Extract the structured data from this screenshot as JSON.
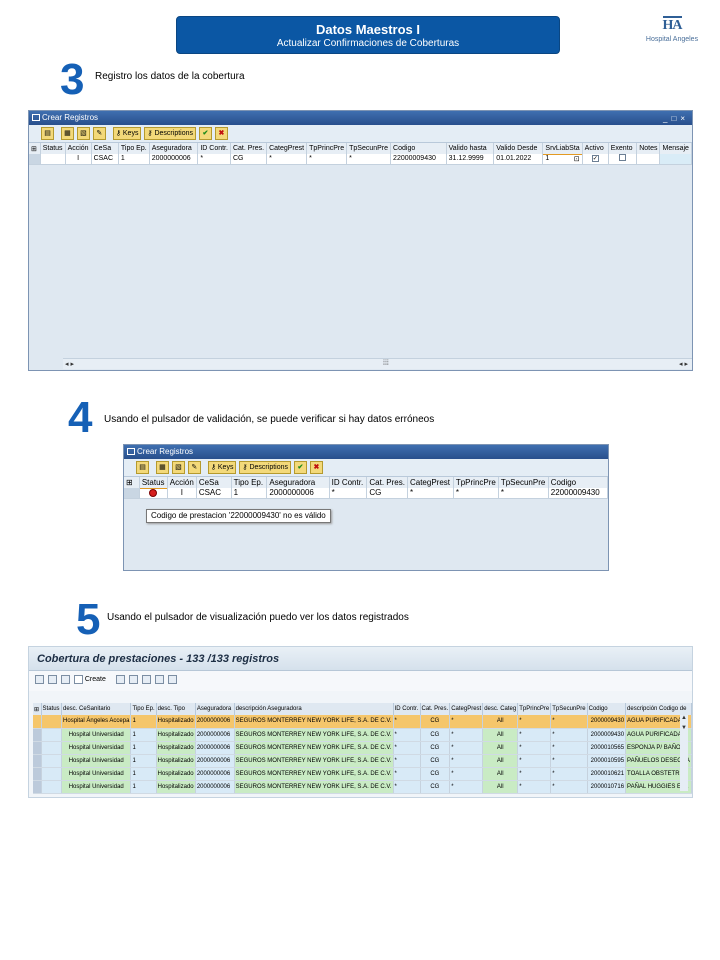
{
  "header": {
    "title": "Datos Maestros I",
    "subtitle": "Actualizar Confirmaciones de Coberturas",
    "logo_mark": "HA",
    "logo_text": "Hospital Angeles"
  },
  "steps": [
    {
      "number": "3",
      "text": "Registro los datos de la cobertura"
    },
    {
      "number": "4",
      "text": "Usando el pulsador de validación, se puede verificar si hay datos erróneos"
    },
    {
      "number": "5",
      "text": "Usando el pulsador de visualización puedo ver los datos registrados"
    }
  ],
  "window1": {
    "title": "Crear Registros",
    "keys_label": "Keys",
    "descriptions_label": "Descriptions",
    "columns": [
      "Status",
      "Acción",
      "CeSa",
      "Tipo Ep.",
      "Aseguradora",
      "ID Contr.",
      "Cat. Pres.",
      "CategPrest",
      "TpPrincPre",
      "TpSecunPre",
      "Codigo",
      "Valido hasta",
      "Valido Desde",
      "SrvLiabSta",
      "Activo",
      "Exento",
      "Notes",
      "Mensaje"
    ],
    "row": {
      "status": "",
      "accion": "I",
      "cesa": "CSAC",
      "tipo_ep": "1",
      "aseguradora": "2000000006",
      "id_contr": "*",
      "cat_pres": "CG",
      "categ_prest": "*",
      "tp_princ": "*",
      "tp_secun": "*",
      "codigo": "22000009430",
      "valido_hasta": "31.12.9999",
      "valido_desde": "01.01.2022",
      "srv_liab": "1"
    }
  },
  "window2": {
    "title": "Crear Registros",
    "keys_label": "Keys",
    "descriptions_label": "Descriptions",
    "columns": [
      "Status",
      "Acción",
      "CeSa",
      "Tipo Ep.",
      "Aseguradora",
      "ID Contr.",
      "Cat. Pres.",
      "CategPrest",
      "TpPrincPre",
      "TpSecunPre",
      "Codigo"
    ],
    "row": {
      "accion": "I",
      "cesa": "CSAC",
      "tipo_ep": "1",
      "aseguradora": "2000000006",
      "id_contr": "*",
      "cat_pres": "CG",
      "categ_prest": "*",
      "tp_princ": "*",
      "tp_secun": "*",
      "codigo": "22000009430"
    },
    "tooltip": "Codigo de prestacion '22000009430' no es válido"
  },
  "window3": {
    "title": "Cobertura de prestaciones - 133 /133  registros",
    "create_label": "Create",
    "columns": [
      "Status",
      "desc. CeSanitario",
      "Tipo Ep.",
      "desc. Tipo",
      "Aseguradora",
      "descripción Aseguradora",
      "ID Contr.",
      "Cat. Pres.",
      "CategPrest",
      "desc. Categ",
      "TpPrincPre",
      "TpSecunPre",
      "Codigo",
      "descripción Codigo de"
    ],
    "rows": [
      {
        "cesa": "Hospital Ángeles Accepa",
        "tipo": "1",
        "desc_tipo": "Hospitalizado",
        "aseg": "2000000006",
        "desc_aseg": "SEGUROS MONTERREY NEW YORK LIFE, S.A. DE C.V.",
        "id": "*",
        "cat": "CG",
        "categ": "*",
        "desc_categ": "All",
        "princ": "*",
        "secun": "*",
        "codigo": "2000009430",
        "desc_codigo": "AGUA PURIFICADA D"
      },
      {
        "cesa": "Hospital Universidad",
        "tipo": "1",
        "desc_tipo": "Hospitalizado",
        "aseg": "2000000006",
        "desc_aseg": "SEGUROS MONTERREY NEW YORK LIFE, S.A. DE C.V.",
        "id": "*",
        "cat": "CG",
        "categ": "*",
        "desc_categ": "All",
        "princ": "*",
        "secun": "*",
        "codigo": "2000009430",
        "desc_codigo": "AGUA PURIFICADA D"
      },
      {
        "cesa": "Hospital Universidad",
        "tipo": "1",
        "desc_tipo": "Hospitalizado",
        "aseg": "2000000006",
        "desc_aseg": "SEGUROS MONTERREY NEW YORK LIFE, S.A. DE C.V.",
        "id": "*",
        "cat": "CG",
        "categ": "*",
        "desc_categ": "All",
        "princ": "*",
        "secun": "*",
        "codigo": "2000010565",
        "desc_codigo": "ESPONJA P/ BAÑO"
      },
      {
        "cesa": "Hospital Universidad",
        "tipo": "1",
        "desc_tipo": "Hospitalizado",
        "aseg": "2000000006",
        "desc_aseg": "SEGUROS MONTERREY NEW YORK LIFE, S.A. DE C.V.",
        "id": "*",
        "cat": "CG",
        "categ": "*",
        "desc_categ": "All",
        "princ": "*",
        "secun": "*",
        "codigo": "2000010595",
        "desc_codigo": "PAÑUELOS DESECHA"
      },
      {
        "cesa": "Hospital Universidad",
        "tipo": "1",
        "desc_tipo": "Hospitalizado",
        "aseg": "2000000006",
        "desc_aseg": "SEGUROS MONTERREY NEW YORK LIFE, S.A. DE C.V.",
        "id": "*",
        "cat": "CG",
        "categ": "*",
        "desc_categ": "All",
        "princ": "*",
        "secun": "*",
        "codigo": "2000010621",
        "desc_codigo": "TOALLA OBSTETRIC"
      },
      {
        "cesa": "Hospital Universidad",
        "tipo": "1",
        "desc_tipo": "Hospitalizado",
        "aseg": "2000000006",
        "desc_aseg": "SEGUROS MONTERREY NEW YORK LIFE, S.A. DE C.V.",
        "id": "*",
        "cat": "CG",
        "categ": "*",
        "desc_categ": "All",
        "princ": "*",
        "secun": "*",
        "codigo": "2000010716",
        "desc_codigo": "PAÑAL HUGGIES ETA"
      }
    ]
  },
  "colors": {
    "brand_blue": "#0b57a4",
    "step_blue": "#1560b6",
    "sap_title": "#284f8c",
    "highlight_row": "#f5c66b",
    "green_cell": "#c9ebc4"
  }
}
